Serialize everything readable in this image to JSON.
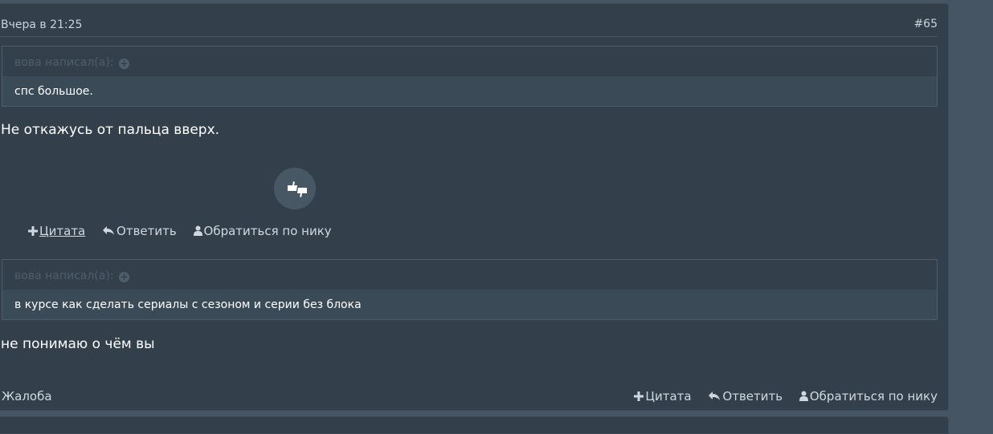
{
  "post": {
    "date": "Вчера в 21:25",
    "number": "#65"
  },
  "quote1": {
    "author": "вова написал(а):",
    "text": "спс большое."
  },
  "reply1": "Не откажусь от пальца вверх.",
  "actions_mid": {
    "quote": "Цитата",
    "reply": "Ответить",
    "mention": "Обратиться по нику"
  },
  "quote2": {
    "author": "вова написал(а):",
    "text": "в курсе как сделать сериалы с сезоном и серии без блока"
  },
  "reply2": "не понимаю о чём вы",
  "footer": {
    "complaint": "Жалоба",
    "quote": "Цитата",
    "reply": "Ответить",
    "mention": "Обратиться по нику"
  },
  "icons": {
    "plus": "plus-icon",
    "reply": "reply-arrow-icon",
    "user": "user-icon",
    "rating": "thumbs-up-down-icon",
    "expand": "expand-circle-icon"
  }
}
